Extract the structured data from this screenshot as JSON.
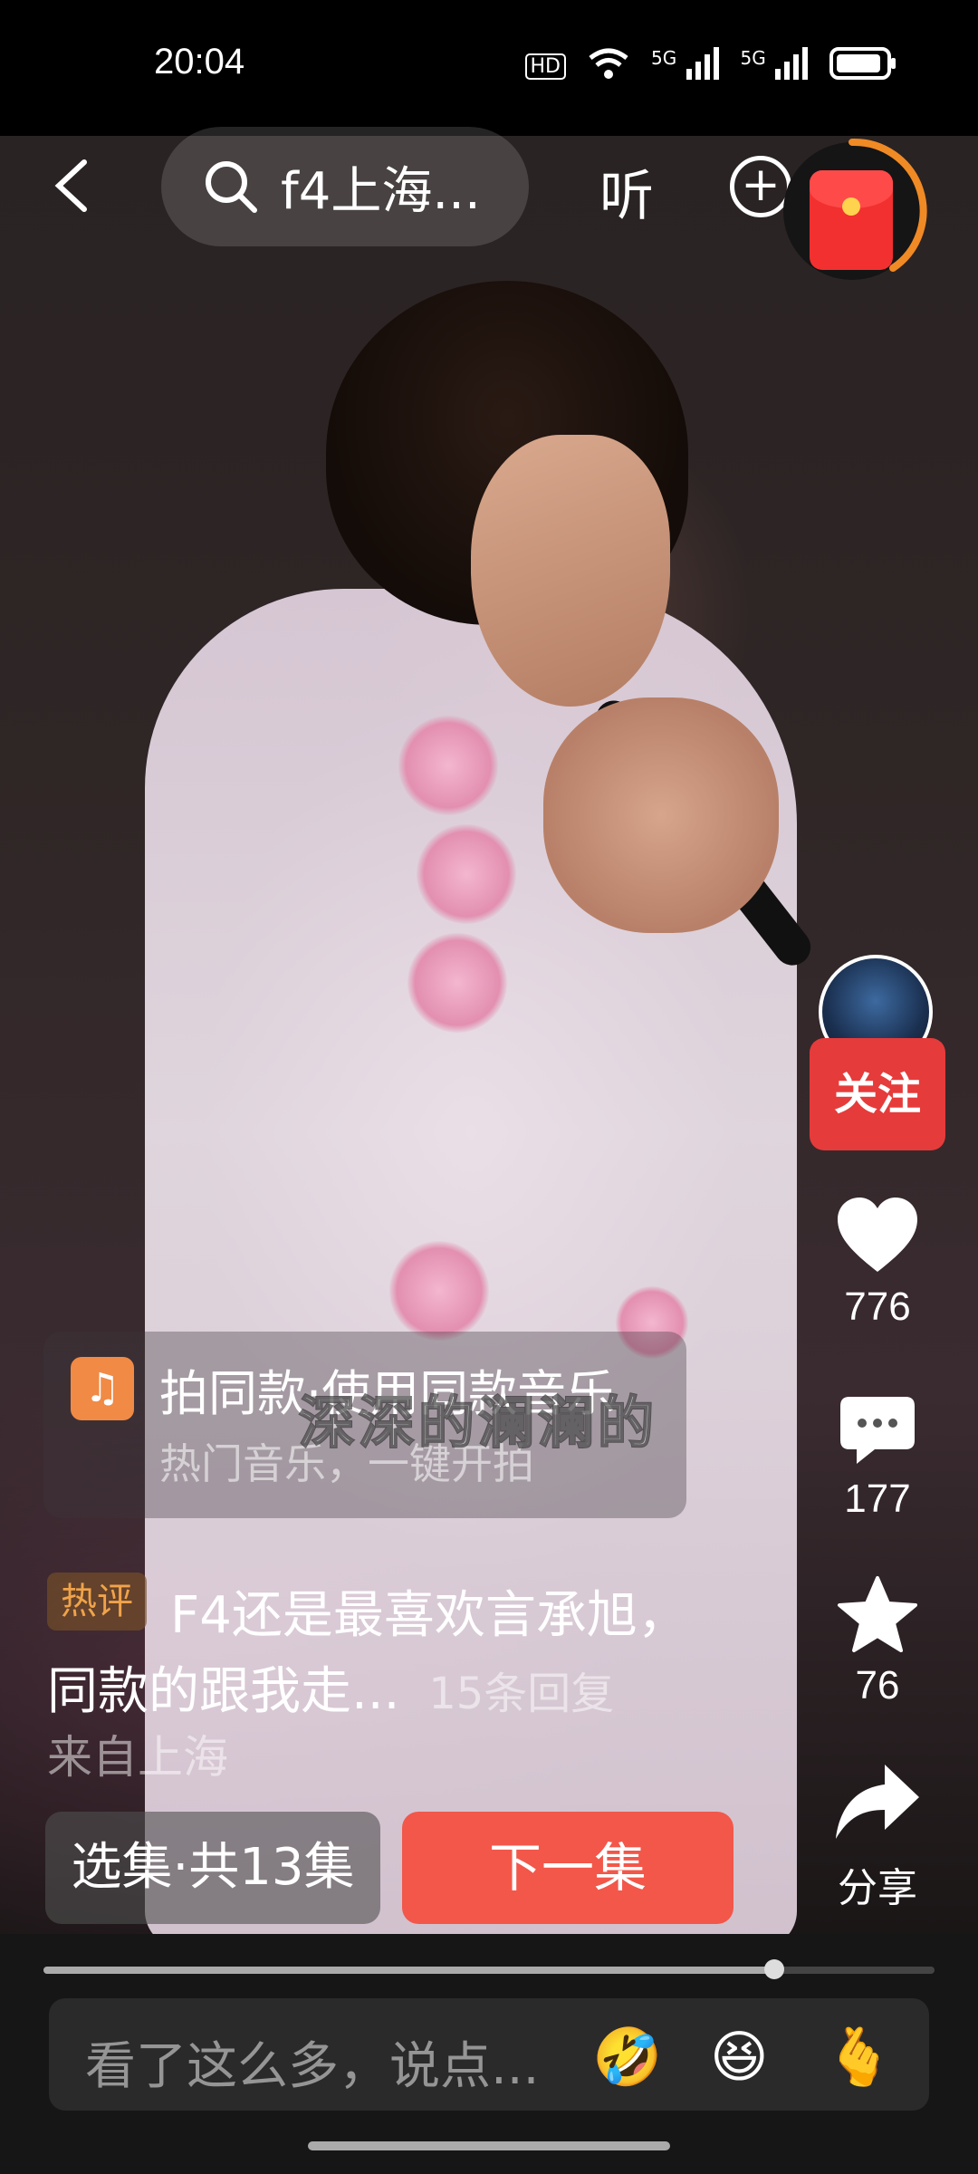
{
  "status_bar": {
    "time": "20:04",
    "hd_label": "HD",
    "net1": "5G",
    "net2": "5G"
  },
  "top_bar": {
    "search_text": "f4上海...",
    "listen_label": "听"
  },
  "author": {
    "follow_label": "关注"
  },
  "actions": {
    "likes": "776",
    "comments": "177",
    "favorites": "76",
    "share_label": "分享"
  },
  "music_card": {
    "title": "拍同款·使用同款音乐",
    "subtitle": "热门音乐，一键开拍",
    "icon": "music-note-icon"
  },
  "lyric": "深深的澜澜的",
  "hot_comment": {
    "badge": "热评",
    "line1": "F4还是最喜欢言承旭，",
    "line2": "同款的跟我走...",
    "replies": "15条回复",
    "location": "来自上海"
  },
  "episodes": {
    "select_label": "选集·共13集",
    "next_label": "下一集"
  },
  "playback": {
    "progress": 0.82
  },
  "comment_input": {
    "placeholder": "看了这么多，说点..."
  },
  "emojis": [
    "🤣",
    "😆",
    "🫰"
  ],
  "colors": {
    "follow": "#e63b3b",
    "next": "#f2574a",
    "music_icon": "#f08a45",
    "hot_badge_text": "#f0a34a"
  }
}
